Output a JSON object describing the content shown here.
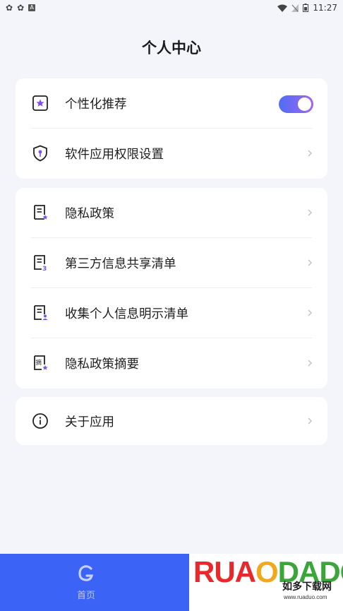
{
  "status_bar": {
    "time": "11:27"
  },
  "page": {
    "title": "个人中心"
  },
  "settings_card": {
    "personalized_recommendation": {
      "label": "个性化推荐",
      "enabled": true
    },
    "app_permissions": {
      "label": "软件应用权限设置"
    }
  },
  "privacy_card": {
    "items": [
      {
        "label": "隐私政策",
        "icon": "document-star-icon"
      },
      {
        "label": "第三方信息共享清单",
        "icon": "document-three-icon"
      },
      {
        "label": "收集个人信息明示清单",
        "icon": "document-user-icon"
      },
      {
        "label": "隐私政策摘要",
        "icon": "document-summary-icon",
        "icon_text": "摘"
      }
    ]
  },
  "about_card": {
    "label": "关于应用"
  },
  "tab_bar": {
    "home_label": "首页"
  },
  "watermark": {
    "brand_left": "RUA",
    "brand_mid": "O",
    "brand_right": "DADO",
    "brand_cn": "如多下载网",
    "url": "www.ruaduo.com"
  },
  "colors": {
    "accent": "#3b64f6",
    "toggle_start": "#4f6df5",
    "toggle_end": "#a066f0",
    "icon_purple": "#7b4ff0",
    "background": "#f4f5fb"
  }
}
